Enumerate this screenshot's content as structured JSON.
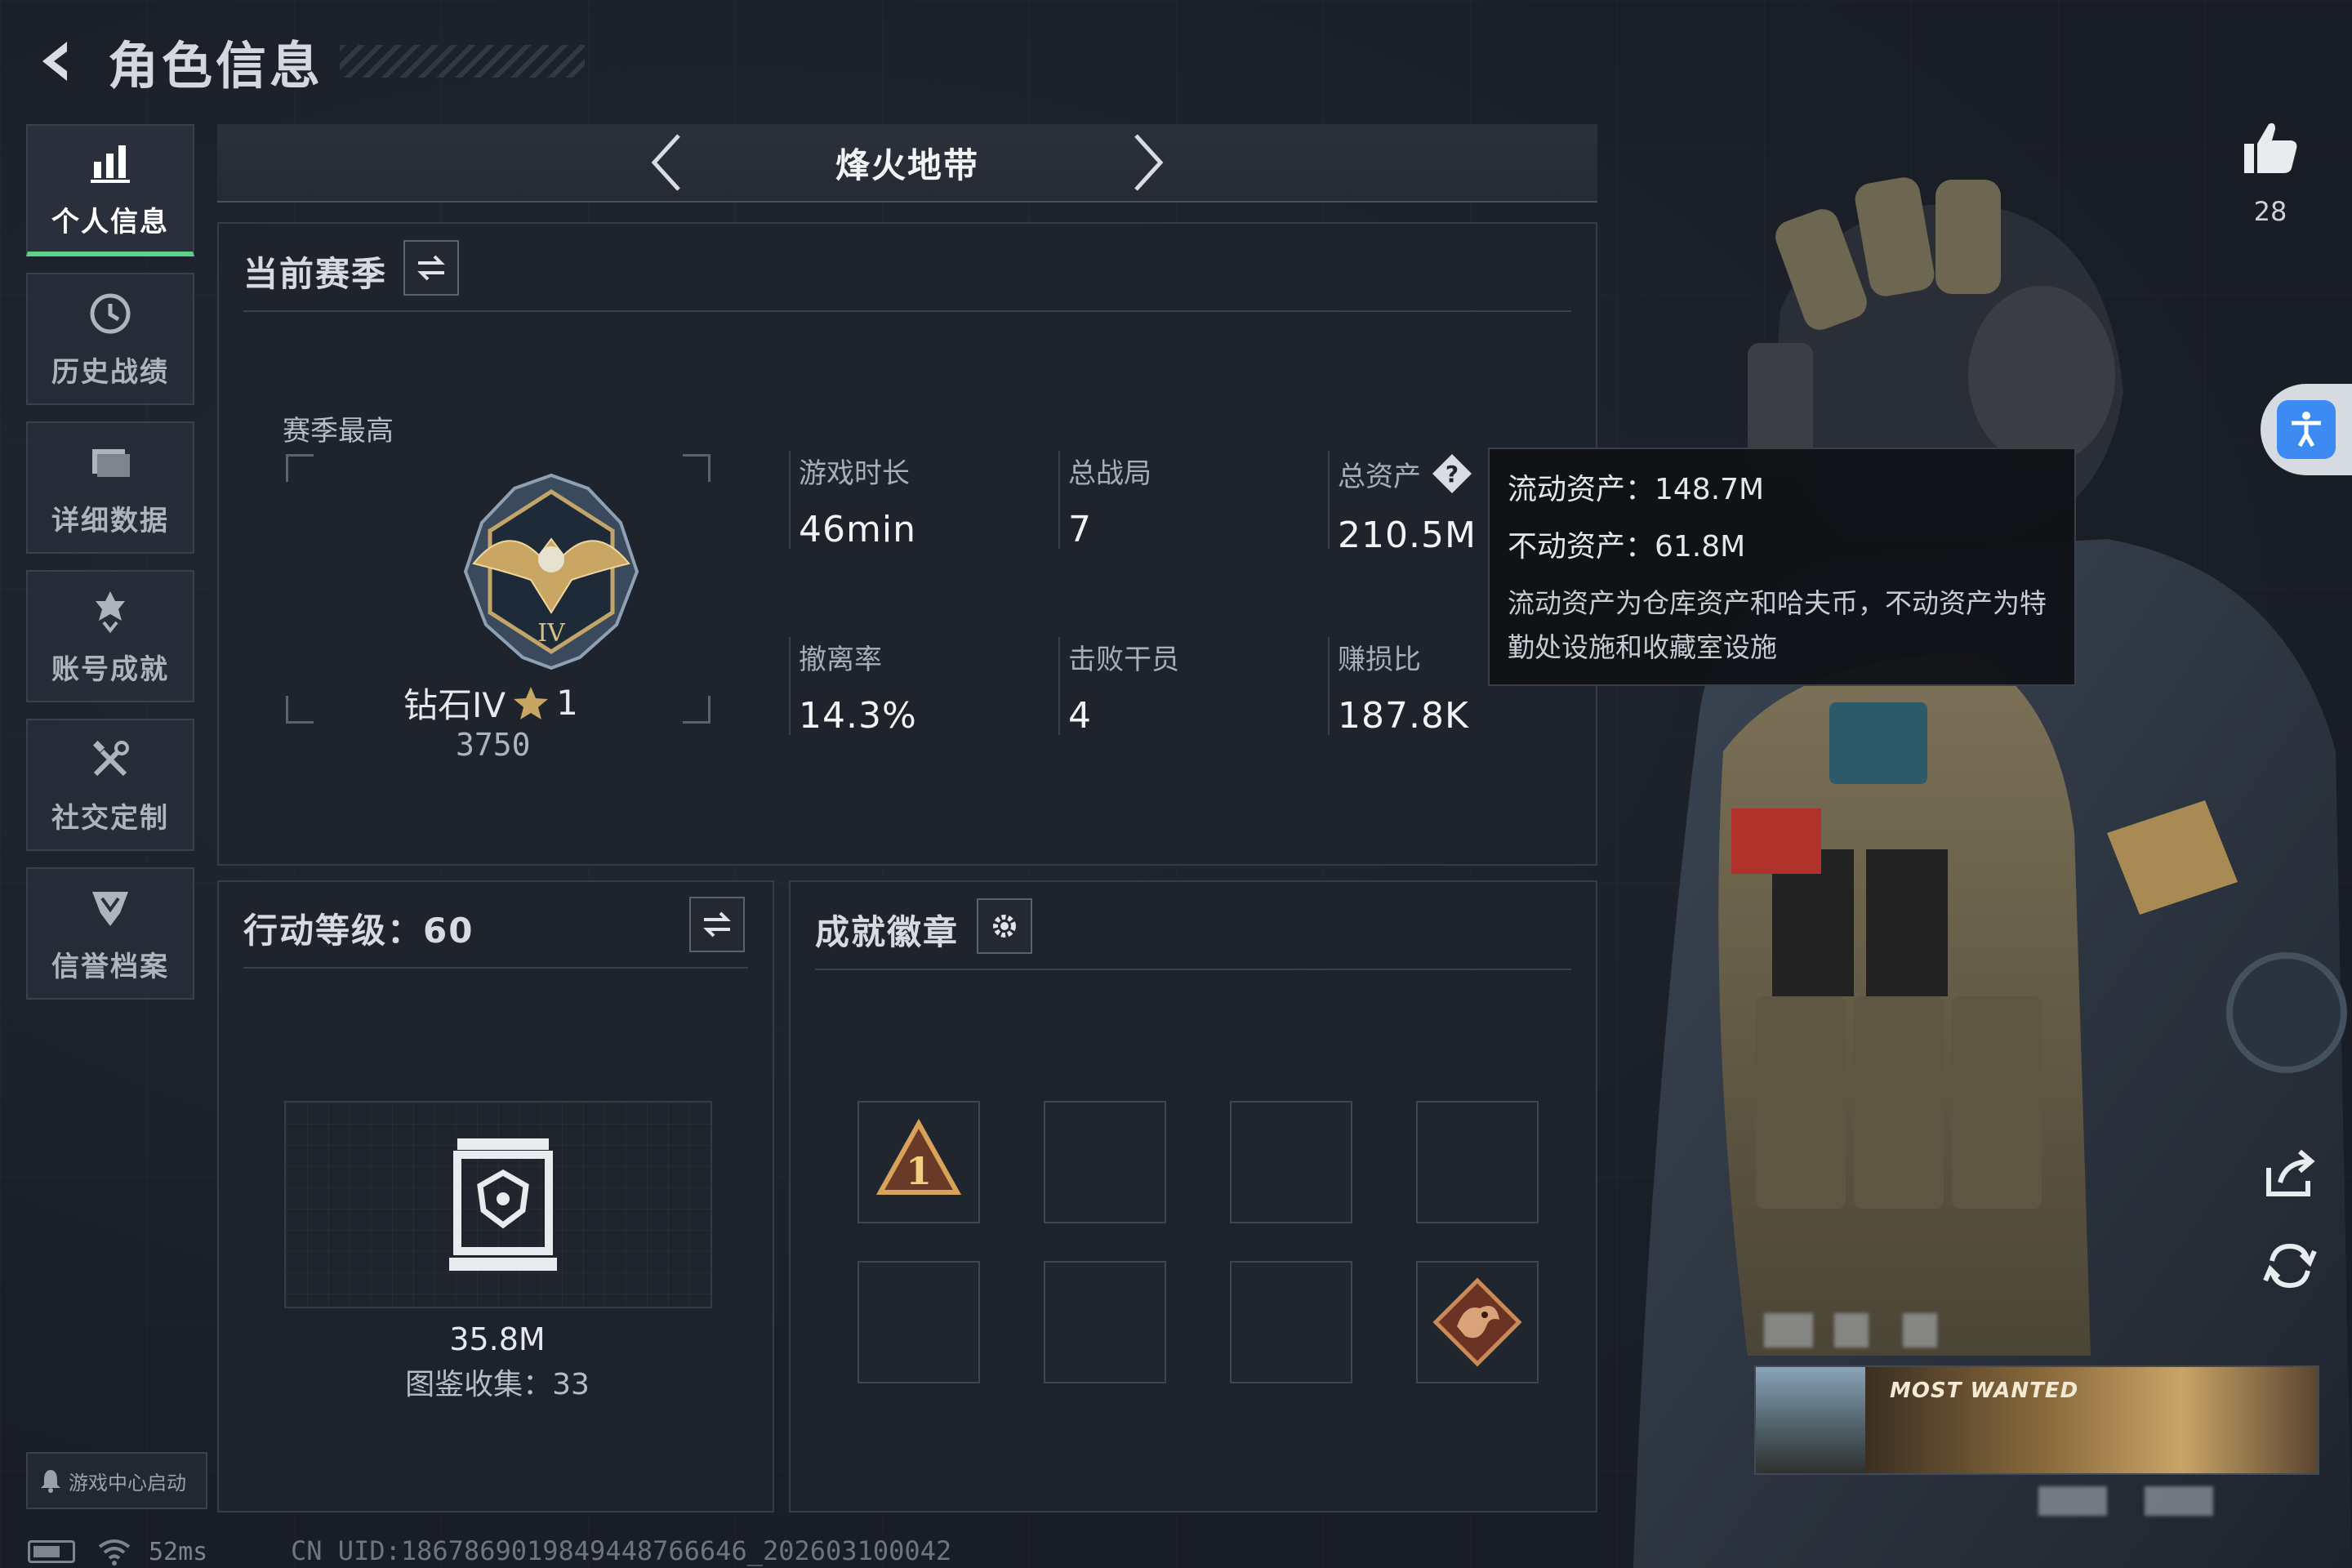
{
  "header": {
    "title": "角色信息"
  },
  "sidebar": {
    "items": [
      {
        "label": "个人信息",
        "active": true,
        "icon": "bar-chart-icon"
      },
      {
        "label": "历史战绩",
        "active": false,
        "icon": "history-clock-icon"
      },
      {
        "label": "详细数据",
        "active": false,
        "icon": "folder-icon"
      },
      {
        "label": "账号成就",
        "active": false,
        "icon": "achievement-icon"
      },
      {
        "label": "社交定制",
        "active": false,
        "icon": "tools-icon"
      },
      {
        "label": "信誉档案",
        "active": false,
        "icon": "shield-rank-icon"
      }
    ],
    "game_center_label": "游戏中心启动"
  },
  "status": {
    "latency": "52ms",
    "uid": "CN UID:1867869019849448766646_202603100042"
  },
  "mode": {
    "title": "烽火地带"
  },
  "season": {
    "title": "当前赛季",
    "best_label": "赛季最高",
    "rank_name": "钻石IV",
    "rank_stars": "1",
    "rank_score": "3750",
    "stats": {
      "play_time": {
        "label": "游戏时长",
        "value": "46min"
      },
      "total_matches": {
        "label": "总战局",
        "value": "7"
      },
      "total_assets": {
        "label": "总资产",
        "value": "210.5M"
      },
      "extract_rate": {
        "label": "撤离率",
        "value": "14.3%"
      },
      "kills": {
        "label": "击败干员",
        "value": "4"
      },
      "profit_ratio": {
        "label": "赚损比",
        "value": "187.8K"
      }
    }
  },
  "tooltip": {
    "liquid": "流动资产：148.7M",
    "fixed": "不动资产：61.8M",
    "description": "流动资产为仓库资产和哈夫币，不动资产为特勤处设施和收藏室设施"
  },
  "action_level": {
    "title": "行动等级：60",
    "collection_value": "35.8M",
    "collection_count": "图鉴收集：33"
  },
  "achievements": {
    "title": "成就徽章",
    "slots": [
      "rank-1-badge",
      "",
      "",
      "",
      "",
      "",
      "",
      "dragon-badge"
    ]
  },
  "right_panel": {
    "likes": "28",
    "banner_text": "MOST WANTED"
  },
  "colors": {
    "accent_green": "#5fd08a",
    "background": "#1a1f28",
    "accessibility_blue": "#3d8bf2"
  }
}
